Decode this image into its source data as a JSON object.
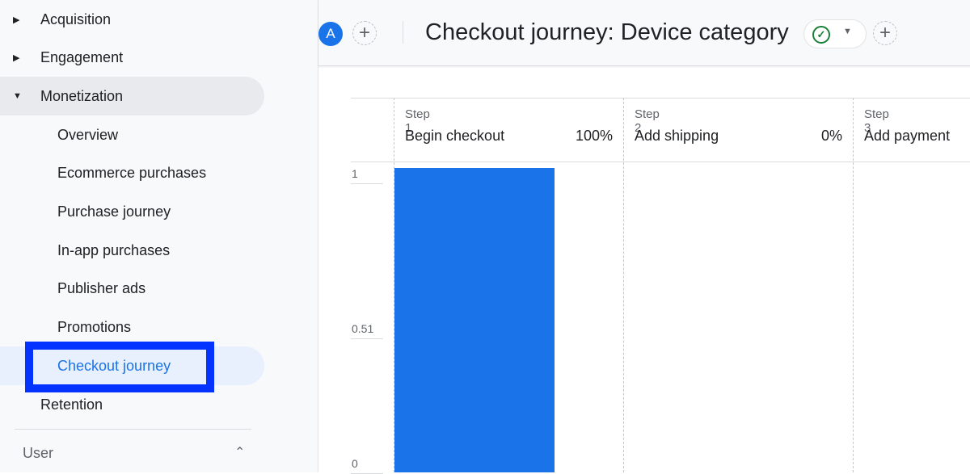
{
  "sidebar": {
    "items": [
      {
        "label": "Acquisition",
        "level": "top",
        "state": "collapsed"
      },
      {
        "label": "Engagement",
        "level": "top",
        "state": "collapsed"
      },
      {
        "label": "Monetization",
        "level": "top",
        "state": "expanded"
      },
      {
        "label": "Overview",
        "level": "sub"
      },
      {
        "label": "Ecommerce purchases",
        "level": "sub"
      },
      {
        "label": "Purchase journey",
        "level": "sub"
      },
      {
        "label": "In-app purchases",
        "level": "sub"
      },
      {
        "label": "Publisher ads",
        "level": "sub"
      },
      {
        "label": "Promotions",
        "level": "sub"
      },
      {
        "label": "Checkout journey",
        "level": "sub",
        "state": "selected"
      },
      {
        "label": "Retention",
        "level": "top"
      }
    ],
    "section_user": "User"
  },
  "header": {
    "avatar_letter": "A",
    "title": "Checkout journey: Device category",
    "status_icon": "check-circle-icon"
  },
  "colors": {
    "accent": "#1a73e8",
    "highlight_box": "#0433ff",
    "status_ok": "#188038"
  },
  "chart_data": {
    "type": "bar",
    "categories": [
      "Begin checkout",
      "Add shipping",
      "Add payment"
    ],
    "step_labels": [
      "Step 1",
      "Step 2",
      "Step 3"
    ],
    "percent_labels": [
      "100%",
      "0%",
      ""
    ],
    "values": [
      1,
      0,
      0
    ],
    "yticks": [
      "1",
      "0.51",
      "0"
    ],
    "ylim": [
      0,
      1
    ],
    "grid": true
  }
}
